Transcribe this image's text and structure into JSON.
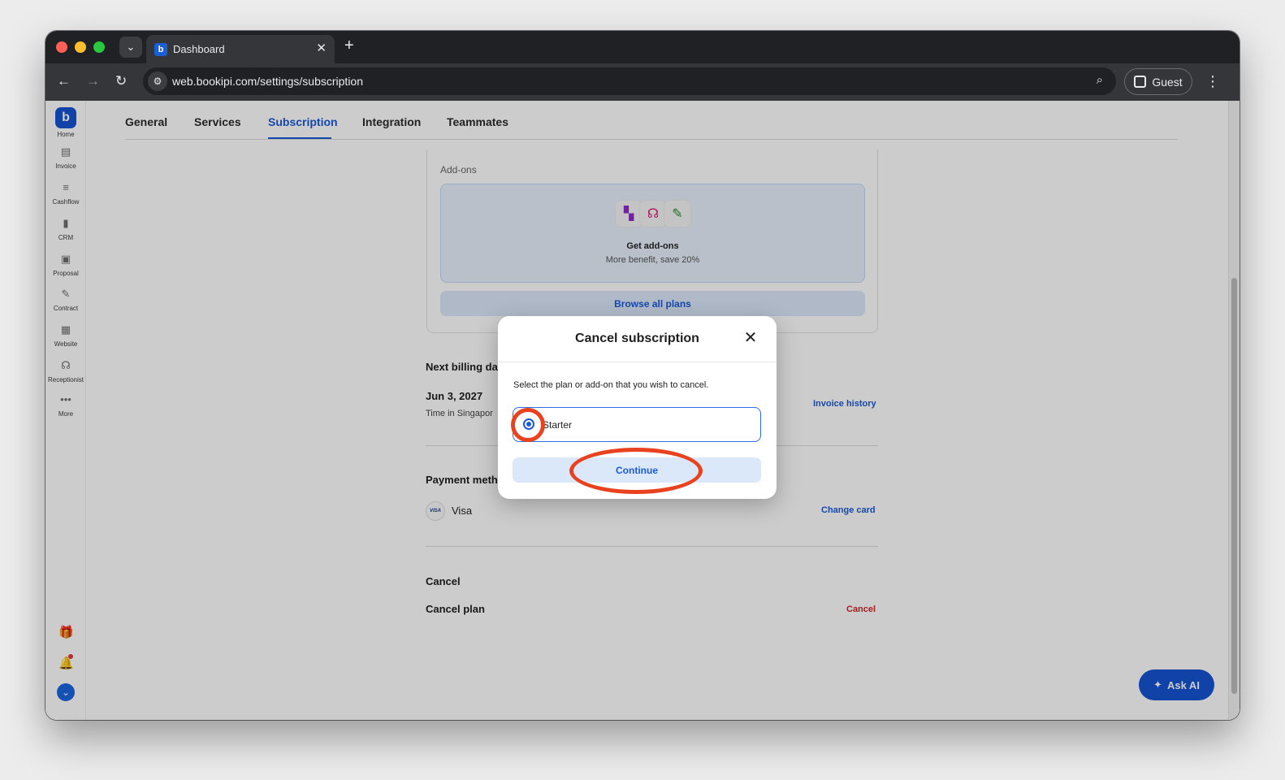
{
  "browser": {
    "tab_title": "Dashboard",
    "url": "web.bookipi.com/settings/subscription",
    "profile_label": "Guest"
  },
  "sidebar": {
    "items": [
      {
        "label": "Home",
        "icon": "home-logo-icon"
      },
      {
        "label": "Invoice",
        "icon": "invoice-icon"
      },
      {
        "label": "Cashflow",
        "icon": "cashflow-icon"
      },
      {
        "label": "CRM",
        "icon": "crm-icon"
      },
      {
        "label": "Proposal",
        "icon": "proposal-icon"
      },
      {
        "label": "Contract",
        "icon": "contract-icon"
      },
      {
        "label": "Website",
        "icon": "website-icon"
      },
      {
        "label": "Receptionist",
        "icon": "headset-icon"
      },
      {
        "label": "More",
        "icon": "more-icon"
      }
    ]
  },
  "settings_tabs": [
    "General",
    "Services",
    "Subscription",
    "Integration",
    "Teammates"
  ],
  "active_tab": "Subscription",
  "addons": {
    "heading": "Add-ons",
    "title": "Get add-ons",
    "subtitle": "More benefit, save 20%",
    "browse_label": "Browse all plans"
  },
  "billing": {
    "label": "Next billing dat",
    "date": "Jun 3, 2027",
    "timezone": "Time in Singapor",
    "link": "Invoice history"
  },
  "payment": {
    "label": "Payment meth",
    "card": "Visa",
    "badge": "VISA",
    "link": "Change card"
  },
  "cancel_section": {
    "heading": "Cancel",
    "row_label": "Cancel plan",
    "link": "Cancel"
  },
  "ask_ai_label": "Ask AI",
  "modal": {
    "title": "Cancel subscription",
    "prompt": "Select the plan or add-on that you wish to cancel.",
    "option": "Starter",
    "option_selected": true,
    "continue_label": "Continue"
  },
  "colors": {
    "accent": "#1b5ad6",
    "danger": "#d32626",
    "annotation": "#e8431e"
  }
}
